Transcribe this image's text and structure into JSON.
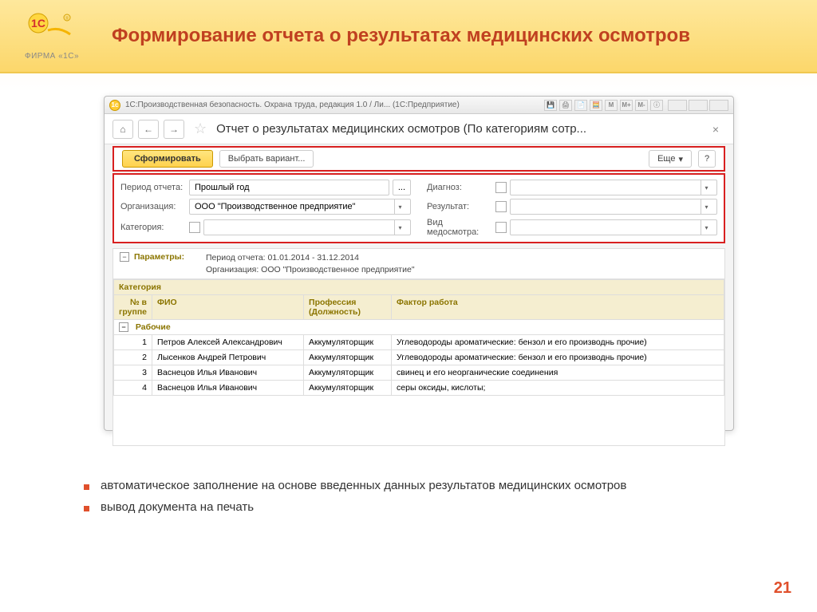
{
  "logo": {
    "brand": "1С",
    "caption": "ФИРМА «1С»"
  },
  "slide_title": "Формирование отчета о результатах медицинских осмотров",
  "titlebar": {
    "text": "1С:Производственная безопасность. Охрана труда, редакция 1.0 / Ли... (1С:Предприятие)",
    "m_buttons": [
      "M",
      "M+",
      "M-"
    ]
  },
  "nav": {
    "home": "⌂",
    "back": "←",
    "fwd": "→"
  },
  "form_title": "Отчет о результатах медицинских осмотров (По категориям сотр...",
  "toolbar": {
    "generate": "Сформировать",
    "variant": "Выбрать вариант...",
    "more": "Еще",
    "help": "?"
  },
  "filters": {
    "period_label": "Период отчета:",
    "period_value": "Прошлый год",
    "org_label": "Организация:",
    "org_value": "ООО \"Производственное предприятие\"",
    "category_label": "Категория:",
    "diag_label": "Диагноз:",
    "result_label": "Результат:",
    "type_label": "Вид медосмотра:"
  },
  "params": {
    "label": "Параметры:",
    "line1": "Период отчета: 01.01.2014 - 31.12.2014",
    "line2": "Организация: ООО \"Производственное предприятие\""
  },
  "table": {
    "cat_header": "Категория",
    "cols": {
      "num": "№ в группе",
      "fio": "ФИО",
      "prof": "Профессия (Должность)",
      "factor": "Фактор работа"
    },
    "group": "Рабочие",
    "rows": [
      {
        "n": "1",
        "fio": "Петров Алексей Александрович",
        "prof": "Аккумуляторщик",
        "factor": "Углеводороды ароматические: бензол и его производнь прочие)"
      },
      {
        "n": "2",
        "fio": "Лысенков Андрей Петрович",
        "prof": "Аккумуляторщик",
        "factor": "Углеводороды ароматические: бензол и его производнь прочие)"
      },
      {
        "n": "3",
        "fio": "Васнецов Илья Иванович",
        "prof": "Аккумуляторщик",
        "factor": "свинец и его неорганические соединения"
      },
      {
        "n": "4",
        "fio": "Васнецов Илья Иванович",
        "prof": "Аккумуляторщик",
        "factor": "серы оксиды, кислоты;"
      }
    ]
  },
  "bullets": [
    "автоматическое заполнение на основе введенных данных результатов медицинских осмотров",
    "вывод документа на печать"
  ],
  "page_num": "21"
}
